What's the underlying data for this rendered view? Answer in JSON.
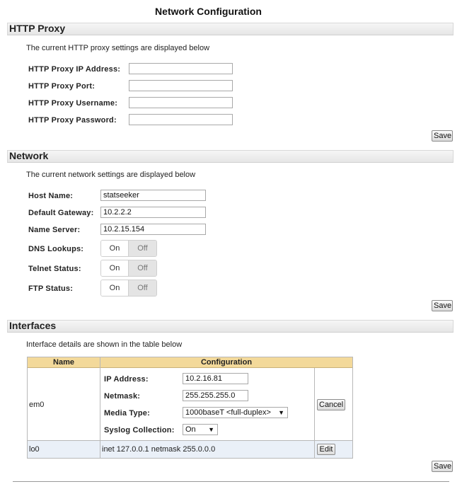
{
  "page_title": "Network Configuration",
  "http_proxy": {
    "header": "HTTP Proxy",
    "note": "The current HTTP proxy settings are displayed below",
    "fields": [
      {
        "label": "HTTP Proxy IP Address:",
        "value": ""
      },
      {
        "label": "HTTP Proxy Port:",
        "value": ""
      },
      {
        "label": "HTTP Proxy Username:",
        "value": ""
      },
      {
        "label": "HTTP Proxy Password:",
        "value": ""
      }
    ],
    "save_label": "Save"
  },
  "network": {
    "header": "Network",
    "note": "The current network settings are displayed below",
    "fields": [
      {
        "label": "Host Name:",
        "value": "statseeker"
      },
      {
        "label": "Default Gateway:",
        "value": "10.2.2.2"
      },
      {
        "label": "Name Server:",
        "value": "10.2.15.154"
      }
    ],
    "toggles": [
      {
        "label": "DNS Lookups:",
        "on": "On",
        "off": "Off",
        "selected": "On"
      },
      {
        "label": "Telnet Status:",
        "on": "On",
        "off": "Off",
        "selected": "On"
      },
      {
        "label": "FTP Status:",
        "on": "On",
        "off": "Off",
        "selected": "On"
      }
    ],
    "save_label": "Save"
  },
  "interfaces": {
    "header": "Interfaces",
    "note": "Interface details are shown in the table below",
    "columns": [
      "Name",
      "Configuration"
    ],
    "rows": [
      {
        "name": "em0",
        "ip_label": "IP Address:",
        "ip_value": "10.2.16.81",
        "netmask_label": "Netmask:",
        "netmask_value": "255.255.255.0",
        "media_label": "Media Type:",
        "media_value": "1000baseT <full-duplex>",
        "syslog_label": "Syslog Collection:",
        "syslog_value": "On",
        "action": "Cancel"
      },
      {
        "name": "lo0",
        "config": "inet 127.0.0.1 netmask 255.0.0.0",
        "action": "Edit"
      }
    ],
    "save_label": "Save"
  },
  "colors": {
    "table_header": "#f3d99a",
    "row_highlight": "#eaf0f8"
  },
  "icons": {
    "dropdown_arrow": "▼"
  }
}
